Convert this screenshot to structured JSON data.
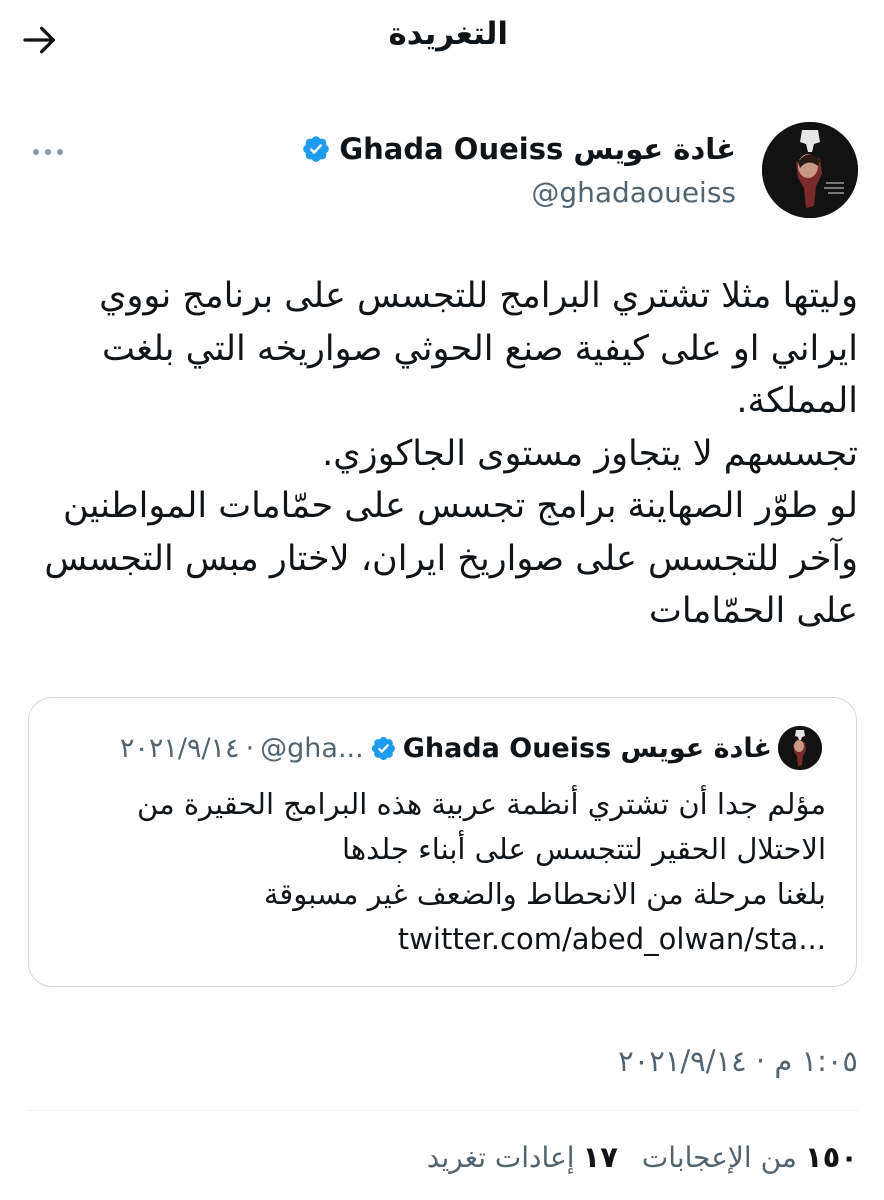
{
  "header": {
    "title": "التغريدة",
    "back_icon": "arrow-right-icon"
  },
  "author": {
    "display_name": "غادة عويس Ghada Oueiss",
    "handle": "@ghadaoueiss",
    "verified": true,
    "verified_color": "#1d9bf0"
  },
  "tweet": {
    "lines": [
      "وليتها مثلا تشتري البرامج للتجسس على برنامج نووي",
      "ايراني او على كيفية صنع الحوثي صواريخه التي بلغت",
      "المملكة.",
      "تجسسهم لا يتجاوز مستوى الجاكوزي.",
      "لو طوّر الصهاينة برامج تجسس على حمّامات المواطنين",
      "وآخر للتجسس على صواريخ ايران، لاختار مبس التجسس",
      "على الحمّامات"
    ],
    "timestamp": "١:٠٥ م · ٢٠٢١/٩/١٤"
  },
  "quote": {
    "display_name": "غادة عويس Ghada Oueiss",
    "handle": "@gha...",
    "separator": "·",
    "date": "٢٠٢١/٩/١٤",
    "lines": [
      "مؤلم جدا أن تشتري أنظمة عربية هذه البرامج الحقيرة من",
      "الاحتلال الحقير لتتجسس على أبناء جلدها",
      "بلغنا مرحلة من الانحطاط والضعف غير مسبوقة",
      "twitter.com/abed_olwan/sta..."
    ]
  },
  "stats": {
    "retweets_count": "١٧",
    "retweets_label": "إعادات تغريد",
    "likes_count": "١٥٠",
    "likes_label": "من الإعجابات"
  }
}
